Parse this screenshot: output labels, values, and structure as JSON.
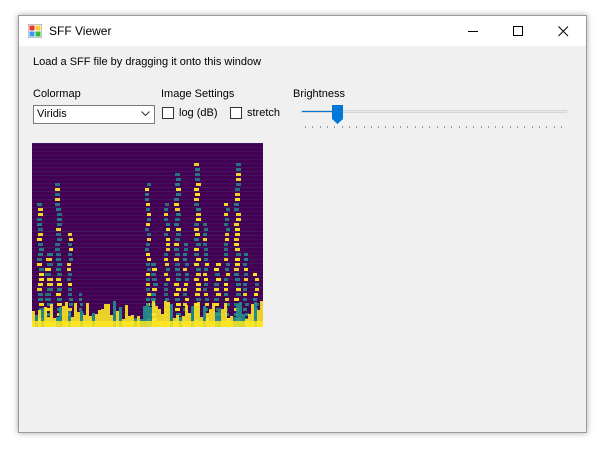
{
  "window": {
    "title": "SFF Viewer",
    "icon": "app-icon"
  },
  "instruction": "Load a SFF file by dragging it onto this window",
  "colormap": {
    "label": "Colormap",
    "selected": "Viridis"
  },
  "image_settings": {
    "label": "Image Settings",
    "log_db": {
      "label": "log (dB)",
      "checked": false
    },
    "stretch": {
      "label": "stretch",
      "checked": false
    }
  },
  "brightness": {
    "label": "Brightness",
    "value_fraction": 0.12,
    "tick_count": 36
  },
  "colors": {
    "accent": "#0078d7",
    "viridis_dark": "#440154",
    "viridis_mid": "#21918c",
    "viridis_bright": "#fde725"
  }
}
